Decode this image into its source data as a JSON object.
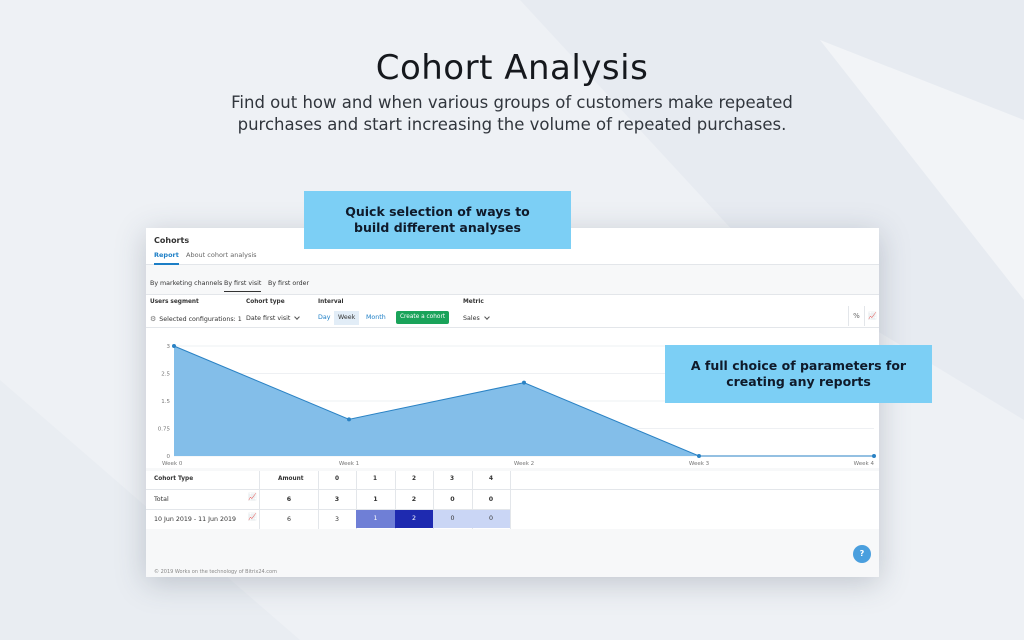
{
  "hero": {
    "title": "Cohort Analysis",
    "subtitle": "Find out how and when various groups of customers make repeated purchases and start increasing the volume of repeated purchases."
  },
  "callouts": {
    "quick": "Quick selection of ways to build different analyses",
    "params": "A full choice of parameters for creating any reports"
  },
  "app": {
    "title": "Cohorts",
    "tabs": [
      {
        "label": "Report",
        "active": true
      },
      {
        "label": "About cohort analysis",
        "active": false
      }
    ],
    "subtabs": [
      {
        "label": "By marketing channels",
        "active": false
      },
      {
        "label": "By first visit",
        "active": true
      },
      {
        "label": "By first order",
        "active": false
      }
    ],
    "filters": {
      "users_segment_label": "Users segment",
      "users_segment_value": "Selected configurations: 1",
      "cohort_type_label": "Cohort type",
      "cohort_type_value": "Date first visit",
      "interval_label": "Interval",
      "interval_options": [
        "Day",
        "Week",
        "Month"
      ],
      "interval_selected": "Week",
      "create_button": "Create a cohort",
      "metric_label": "Metric",
      "metric_value": "Sales"
    },
    "tools": {
      "percent_label": "%"
    },
    "table": {
      "headers": [
        "Cohort Type",
        "Amount",
        "0",
        "1",
        "2",
        "3",
        "4"
      ],
      "rows": [
        {
          "label": "Total",
          "amount": "6",
          "cells": [
            "3",
            "1",
            "2",
            "0",
            "0"
          ]
        },
        {
          "label": "10 Jun 2019 - 11 Jun 2019",
          "amount": "6",
          "cells": [
            "3",
            "1",
            "2",
            "0",
            "0"
          ]
        }
      ]
    },
    "footer": "© 2019 Works on the technology of Bitrix24.com",
    "help_label": "?"
  },
  "chart_data": {
    "type": "area",
    "x": [
      "Week 0",
      "Week 1",
      "Week 2",
      "Week 3",
      "Week 4"
    ],
    "values": [
      3,
      1,
      2,
      0,
      0
    ],
    "ylim": [
      0,
      3
    ],
    "yticks": [
      "3",
      "2.5",
      "1.5",
      "0.75",
      "0"
    ],
    "color": "#7cbbe8",
    "line_color": "#2a82c4",
    "grid": true
  },
  "colors": {
    "accent": "#1c7ec6",
    "create_button": "#1aa35a",
    "callout": "#7ccff5",
    "heat_1": "#6f7fd6",
    "heat_2": "#1e2ab0",
    "heat_0": "#cad6f5"
  }
}
